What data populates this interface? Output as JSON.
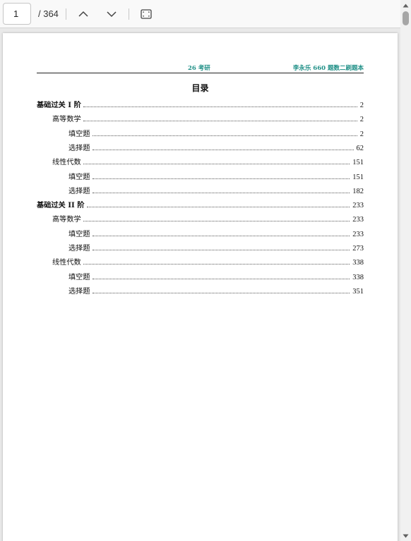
{
  "toolbar": {
    "page_input_value": "1",
    "page_total": "/ 364"
  },
  "document": {
    "header": {
      "center": "26 考研",
      "right": "李永乐 660 题数二刷题本"
    },
    "toc_title": "目录",
    "toc": [
      {
        "label": "基础过关 I 阶",
        "page": "2",
        "level": 1
      },
      {
        "label": "高等数学",
        "page": "2",
        "level": 2
      },
      {
        "label": "填空题",
        "page": "2",
        "level": 3
      },
      {
        "label": "选择题",
        "page": "62",
        "level": 3
      },
      {
        "label": "线性代数",
        "page": "151",
        "level": 2
      },
      {
        "label": "填空题",
        "page": "151",
        "level": 3
      },
      {
        "label": "选择题",
        "page": "182",
        "level": 3
      },
      {
        "label": "基础过关 II 阶",
        "page": "233",
        "level": 1
      },
      {
        "label": "高等数学",
        "page": "233",
        "level": 2
      },
      {
        "label": "填空题",
        "page": "233",
        "level": 3
      },
      {
        "label": "选择题",
        "page": "273",
        "level": 3
      },
      {
        "label": "线性代数",
        "page": "338",
        "level": 2
      },
      {
        "label": "填空题",
        "page": "338",
        "level": 3
      },
      {
        "label": "选择题",
        "page": "351",
        "level": 3
      }
    ]
  },
  "colors": {
    "header_accent": "#1e8f86",
    "toolbar_bg": "#f9f9f9",
    "viewer_bg": "#e9e9e9"
  },
  "icons": [
    "chevron-up-icon",
    "chevron-down-icon",
    "fit-page-icon"
  ]
}
